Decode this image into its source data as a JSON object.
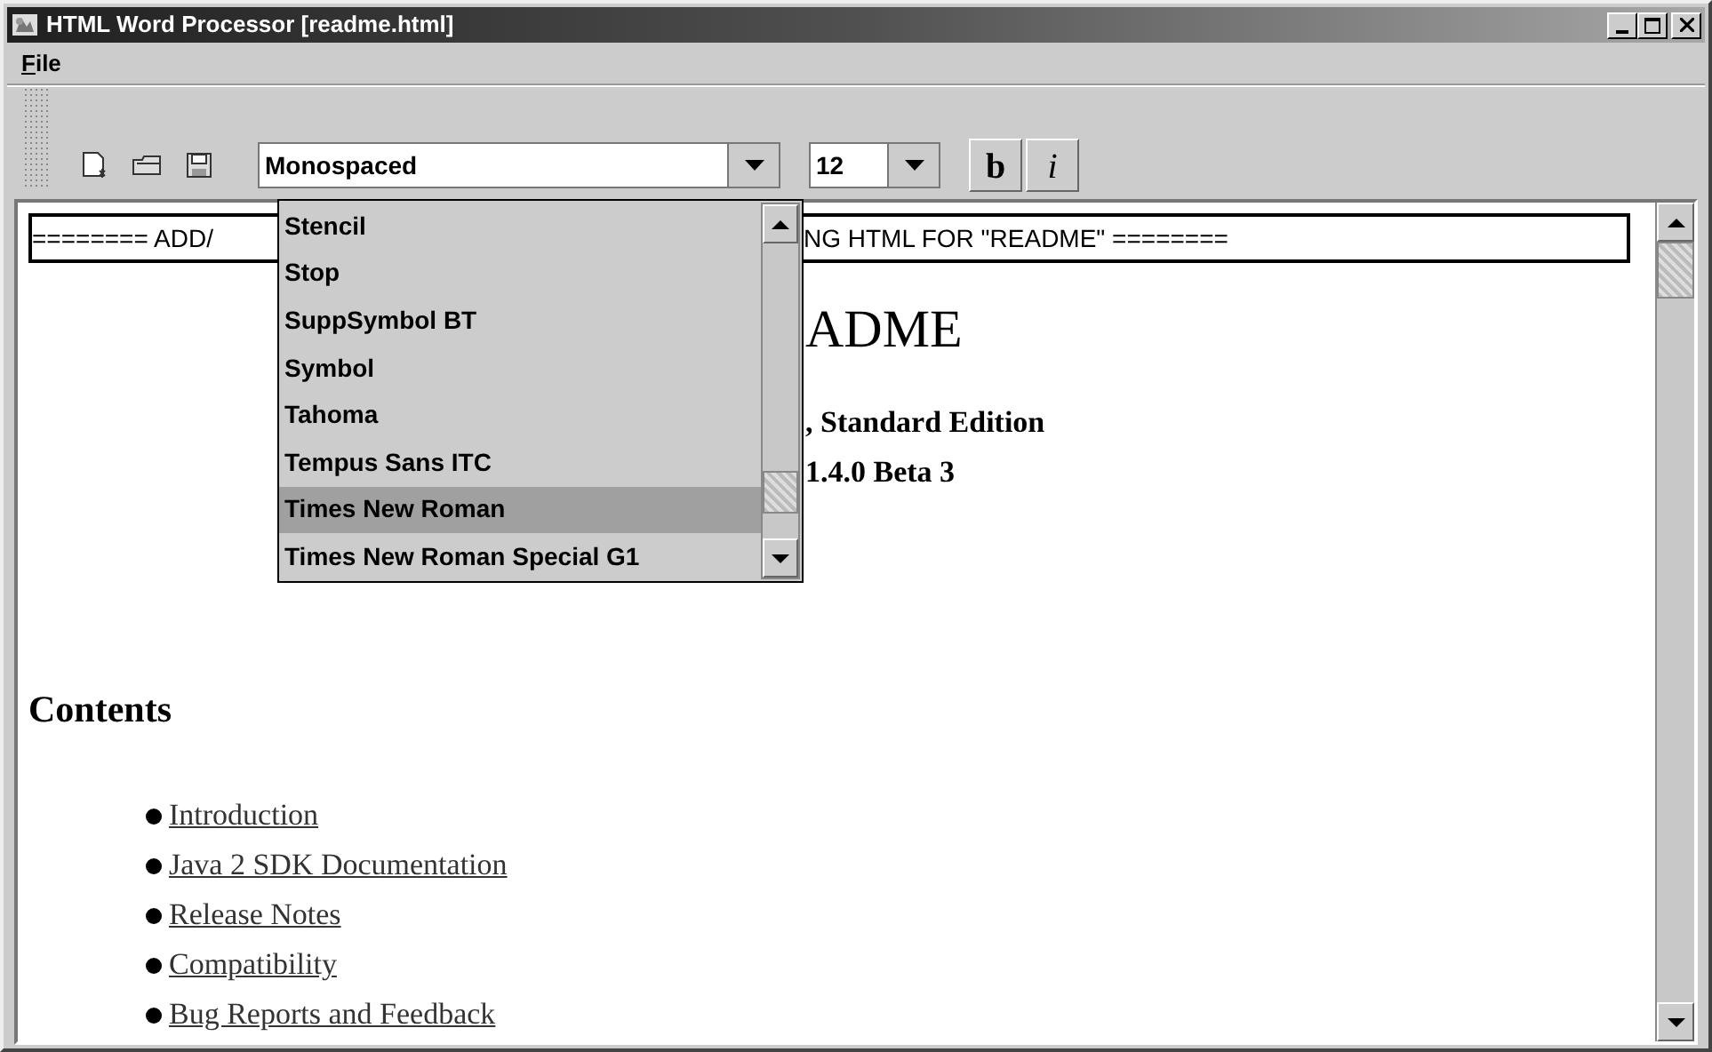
{
  "window": {
    "title": "HTML Word Processor [readme.html]"
  },
  "menu": [
    {
      "label": "File"
    }
  ],
  "toolbar": {
    "font_combo": {
      "value": "Monospaced",
      "expanded": true
    },
    "size_combo": {
      "value": "12",
      "expanded": false
    },
    "style_buttons": [
      {
        "kind": "bold",
        "label": "b"
      },
      {
        "kind": "italic",
        "label": "i"
      }
    ]
  },
  "font_list": [
    {
      "label": "Stencil",
      "selected": false
    },
    {
      "label": "Stop",
      "selected": false
    },
    {
      "label": "SuppSymbol BT",
      "selected": false
    },
    {
      "label": "Symbol",
      "selected": false
    },
    {
      "label": "Tahoma",
      "selected": false
    },
    {
      "label": "Tempus Sans ITC",
      "selected": false
    },
    {
      "label": "Times New Roman",
      "selected": true
    },
    {
      "label": "Times New Roman Special G1",
      "selected": false
    }
  ],
  "document": {
    "banner_left": "======== ADD/",
    "banner_right": "NG HTML FOR \"README\" ========",
    "title": "ADME",
    "subtitle_lines": [
      ", Standard Edition",
      "1.4.0 Beta 3"
    ],
    "section_heading": "Contents",
    "links": [
      "Introduction",
      "Java 2 SDK Documentation",
      "Release Notes",
      "Compatibility",
      "Bug Reports and Feedback"
    ]
  }
}
